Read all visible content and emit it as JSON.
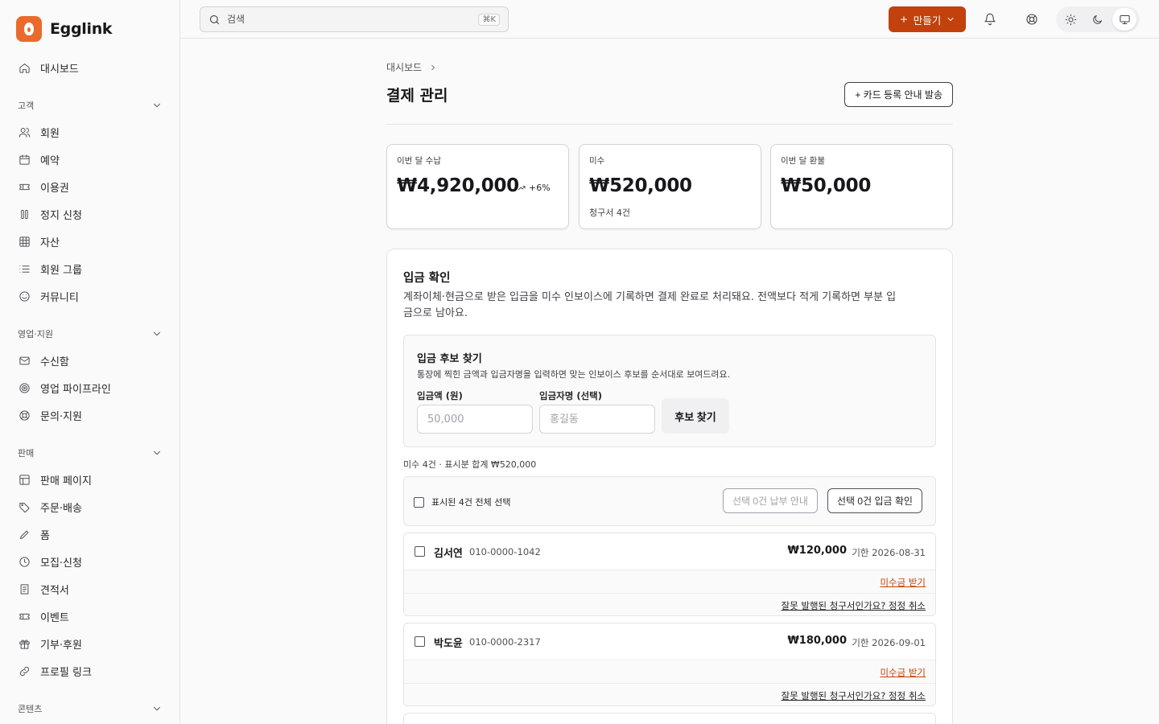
{
  "app": {
    "name": "Egglink",
    "brand_color": "#ea6a2c",
    "accent_color": "#c2410c"
  },
  "sidebar": {
    "top_item": {
      "label": "대시보드",
      "icon": "home-icon"
    },
    "groups": [
      {
        "label": "고객",
        "items": [
          {
            "label": "회원",
            "icon": "users-icon"
          },
          {
            "label": "예약",
            "icon": "calendar-icon"
          },
          {
            "label": "이용권",
            "icon": "ticket-icon"
          },
          {
            "label": "정지 신청",
            "icon": "pause-icon"
          },
          {
            "label": "자산",
            "icon": "grid-icon"
          },
          {
            "label": "회원 그룹",
            "icon": "list-icon"
          },
          {
            "label": "커뮤니티",
            "icon": "smile-icon"
          }
        ]
      },
      {
        "label": "영업·지원",
        "items": [
          {
            "label": "수신함",
            "icon": "mail-icon"
          },
          {
            "label": "영업 파이프라인",
            "icon": "target-icon"
          },
          {
            "label": "문의·지원",
            "icon": "lifebuoy-icon"
          }
        ]
      },
      {
        "label": "판매",
        "items": [
          {
            "label": "판매 페이지",
            "icon": "layout-icon"
          },
          {
            "label": "주문·배송",
            "icon": "tag-icon"
          },
          {
            "label": "폼",
            "icon": "pen-icon"
          },
          {
            "label": "모집·신청",
            "icon": "clock-icon"
          },
          {
            "label": "견적서",
            "icon": "receipt-icon"
          },
          {
            "label": "이벤트",
            "icon": "ticket-icon"
          },
          {
            "label": "기부·후원",
            "icon": "gift-icon"
          },
          {
            "label": "프로필 링크",
            "icon": "link-icon"
          }
        ]
      },
      {
        "label": "콘텐츠",
        "items": []
      }
    ]
  },
  "topbar": {
    "search_placeholder": "검색",
    "search_shortcut": "⌘K",
    "create_label": "만들기",
    "theme_active": "system"
  },
  "main": {
    "breadcrumb": [
      "대시보드"
    ],
    "title": "결제 관리",
    "send_card_label": "+ 카드 등록 안내 발송",
    "stats": [
      {
        "label": "이번 달 수납",
        "value": "₩4,920,000",
        "trend": "+6%"
      },
      {
        "label": "미수",
        "value": "₩520,000",
        "sub": "청구서 4건"
      },
      {
        "label": "이번 달 환불",
        "value": "₩50,000"
      }
    ],
    "deposit": {
      "title": "입금 확인",
      "description": "계좌이체·현금으로 받은 입금을 미수 인보이스에 기록하면 결제 완료로 처리돼요. 전액보다 적게 기록하면 부분 입금으로 남아요.",
      "finder": {
        "title": "입금 후보 찾기",
        "description": "통장에 찍힌 금액과 입금자명을 입력하면 맞는 인보이스 후보를 순서대로 보여드려요.",
        "amount_label": "입금액 (원)",
        "amount_placeholder": "50,000",
        "name_label": "입금자명 (선택)",
        "name_placeholder": "홍길동",
        "find_label": "후보 찾기"
      },
      "summary": "미수 4건 · 표시분 합계 ₩520,000",
      "select_all_label": "표시된 4건 전체 선택",
      "notify_selected_label": "선택 0건 납부 안내",
      "confirm_selected_label": "선택 0건 입금 확인",
      "invoices": [
        {
          "name": "김서연",
          "phone": "010-0000-1042",
          "amount": "₩120,000",
          "due": "기한 2026-08-31",
          "collect_label": "미수금 받기",
          "cancel_label": "잘못 발행된 청구서인가요? 정정 취소"
        },
        {
          "name": "박도윤",
          "phone": "010-0000-2317",
          "amount": "₩180,000",
          "due": "기한 2026-09-01",
          "collect_label": "미수금 받기",
          "cancel_label": "잘못 발행된 청구서인가요? 정정 취소"
        }
      ]
    }
  }
}
